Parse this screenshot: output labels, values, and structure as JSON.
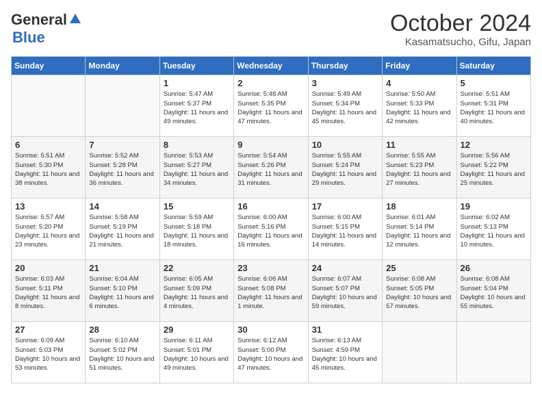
{
  "logo": {
    "general": "General",
    "blue": "Blue"
  },
  "header": {
    "month": "October 2024",
    "location": "Kasamatsucho, Gifu, Japan"
  },
  "days_header": [
    "Sunday",
    "Monday",
    "Tuesday",
    "Wednesday",
    "Thursday",
    "Friday",
    "Saturday"
  ],
  "weeks": [
    [
      {
        "day": "",
        "content": ""
      },
      {
        "day": "",
        "content": ""
      },
      {
        "day": "1",
        "content": "Sunrise: 5:47 AM\nSunset: 5:37 PM\nDaylight: 11 hours and 49 minutes."
      },
      {
        "day": "2",
        "content": "Sunrise: 5:48 AM\nSunset: 5:35 PM\nDaylight: 11 hours and 47 minutes."
      },
      {
        "day": "3",
        "content": "Sunrise: 5:49 AM\nSunset: 5:34 PM\nDaylight: 11 hours and 45 minutes."
      },
      {
        "day": "4",
        "content": "Sunrise: 5:50 AM\nSunset: 5:33 PM\nDaylight: 11 hours and 42 minutes."
      },
      {
        "day": "5",
        "content": "Sunrise: 5:51 AM\nSunset: 5:31 PM\nDaylight: 11 hours and 40 minutes."
      }
    ],
    [
      {
        "day": "6",
        "content": "Sunrise: 5:51 AM\nSunset: 5:30 PM\nDaylight: 11 hours and 38 minutes."
      },
      {
        "day": "7",
        "content": "Sunrise: 5:52 AM\nSunset: 5:28 PM\nDaylight: 11 hours and 36 minutes."
      },
      {
        "day": "8",
        "content": "Sunrise: 5:53 AM\nSunset: 5:27 PM\nDaylight: 11 hours and 34 minutes."
      },
      {
        "day": "9",
        "content": "Sunrise: 5:54 AM\nSunset: 5:26 PM\nDaylight: 11 hours and 31 minutes."
      },
      {
        "day": "10",
        "content": "Sunrise: 5:55 AM\nSunset: 5:24 PM\nDaylight: 11 hours and 29 minutes."
      },
      {
        "day": "11",
        "content": "Sunrise: 5:55 AM\nSunset: 5:23 PM\nDaylight: 11 hours and 27 minutes."
      },
      {
        "day": "12",
        "content": "Sunrise: 5:56 AM\nSunset: 5:22 PM\nDaylight: 11 hours and 25 minutes."
      }
    ],
    [
      {
        "day": "13",
        "content": "Sunrise: 5:57 AM\nSunset: 5:20 PM\nDaylight: 11 hours and 23 minutes."
      },
      {
        "day": "14",
        "content": "Sunrise: 5:58 AM\nSunset: 5:19 PM\nDaylight: 11 hours and 21 minutes."
      },
      {
        "day": "15",
        "content": "Sunrise: 5:59 AM\nSunset: 5:18 PM\nDaylight: 11 hours and 18 minutes."
      },
      {
        "day": "16",
        "content": "Sunrise: 6:00 AM\nSunset: 5:16 PM\nDaylight: 11 hours and 16 minutes."
      },
      {
        "day": "17",
        "content": "Sunrise: 6:00 AM\nSunset: 5:15 PM\nDaylight: 11 hours and 14 minutes."
      },
      {
        "day": "18",
        "content": "Sunrise: 6:01 AM\nSunset: 5:14 PM\nDaylight: 11 hours and 12 minutes."
      },
      {
        "day": "19",
        "content": "Sunrise: 6:02 AM\nSunset: 5:13 PM\nDaylight: 11 hours and 10 minutes."
      }
    ],
    [
      {
        "day": "20",
        "content": "Sunrise: 6:03 AM\nSunset: 5:11 PM\nDaylight: 11 hours and 8 minutes."
      },
      {
        "day": "21",
        "content": "Sunrise: 6:04 AM\nSunset: 5:10 PM\nDaylight: 11 hours and 6 minutes."
      },
      {
        "day": "22",
        "content": "Sunrise: 6:05 AM\nSunset: 5:09 PM\nDaylight: 11 hours and 4 minutes."
      },
      {
        "day": "23",
        "content": "Sunrise: 6:06 AM\nSunset: 5:08 PM\nDaylight: 11 hours and 1 minute."
      },
      {
        "day": "24",
        "content": "Sunrise: 6:07 AM\nSunset: 5:07 PM\nDaylight: 10 hours and 59 minutes."
      },
      {
        "day": "25",
        "content": "Sunrise: 6:08 AM\nSunset: 5:05 PM\nDaylight: 10 hours and 57 minutes."
      },
      {
        "day": "26",
        "content": "Sunrise: 6:08 AM\nSunset: 5:04 PM\nDaylight: 10 hours and 55 minutes."
      }
    ],
    [
      {
        "day": "27",
        "content": "Sunrise: 6:09 AM\nSunset: 5:03 PM\nDaylight: 10 hours and 53 minutes."
      },
      {
        "day": "28",
        "content": "Sunrise: 6:10 AM\nSunset: 5:02 PM\nDaylight: 10 hours and 51 minutes."
      },
      {
        "day": "29",
        "content": "Sunrise: 6:11 AM\nSunset: 5:01 PM\nDaylight: 10 hours and 49 minutes."
      },
      {
        "day": "30",
        "content": "Sunrise: 6:12 AM\nSunset: 5:00 PM\nDaylight: 10 hours and 47 minutes."
      },
      {
        "day": "31",
        "content": "Sunrise: 6:13 AM\nSunset: 4:59 PM\nDaylight: 10 hours and 45 minutes."
      },
      {
        "day": "",
        "content": ""
      },
      {
        "day": "",
        "content": ""
      }
    ]
  ]
}
